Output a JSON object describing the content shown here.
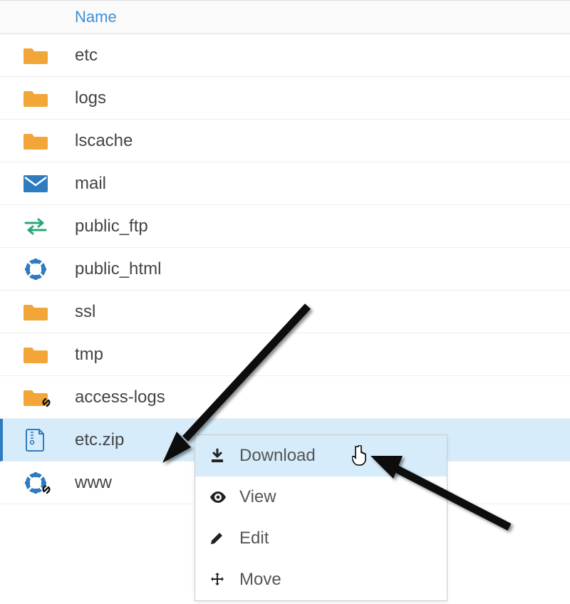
{
  "header": {
    "name_col": "Name"
  },
  "rows": [
    {
      "icon": "folder",
      "name": "etc"
    },
    {
      "icon": "folder",
      "name": "logs"
    },
    {
      "icon": "folder",
      "name": "lscache"
    },
    {
      "icon": "mail",
      "name": "mail"
    },
    {
      "icon": "transfer",
      "name": "public_ftp"
    },
    {
      "icon": "globe",
      "name": "public_html"
    },
    {
      "icon": "folder",
      "name": "ssl"
    },
    {
      "icon": "folder",
      "name": "tmp"
    },
    {
      "icon": "folder-link",
      "name": "access-logs"
    },
    {
      "icon": "zip",
      "name": "etc.zip",
      "selected": true
    },
    {
      "icon": "globe-link",
      "name": "www"
    }
  ],
  "menu": {
    "download": "Download",
    "view": "View",
    "edit": "Edit",
    "move": "Move"
  }
}
